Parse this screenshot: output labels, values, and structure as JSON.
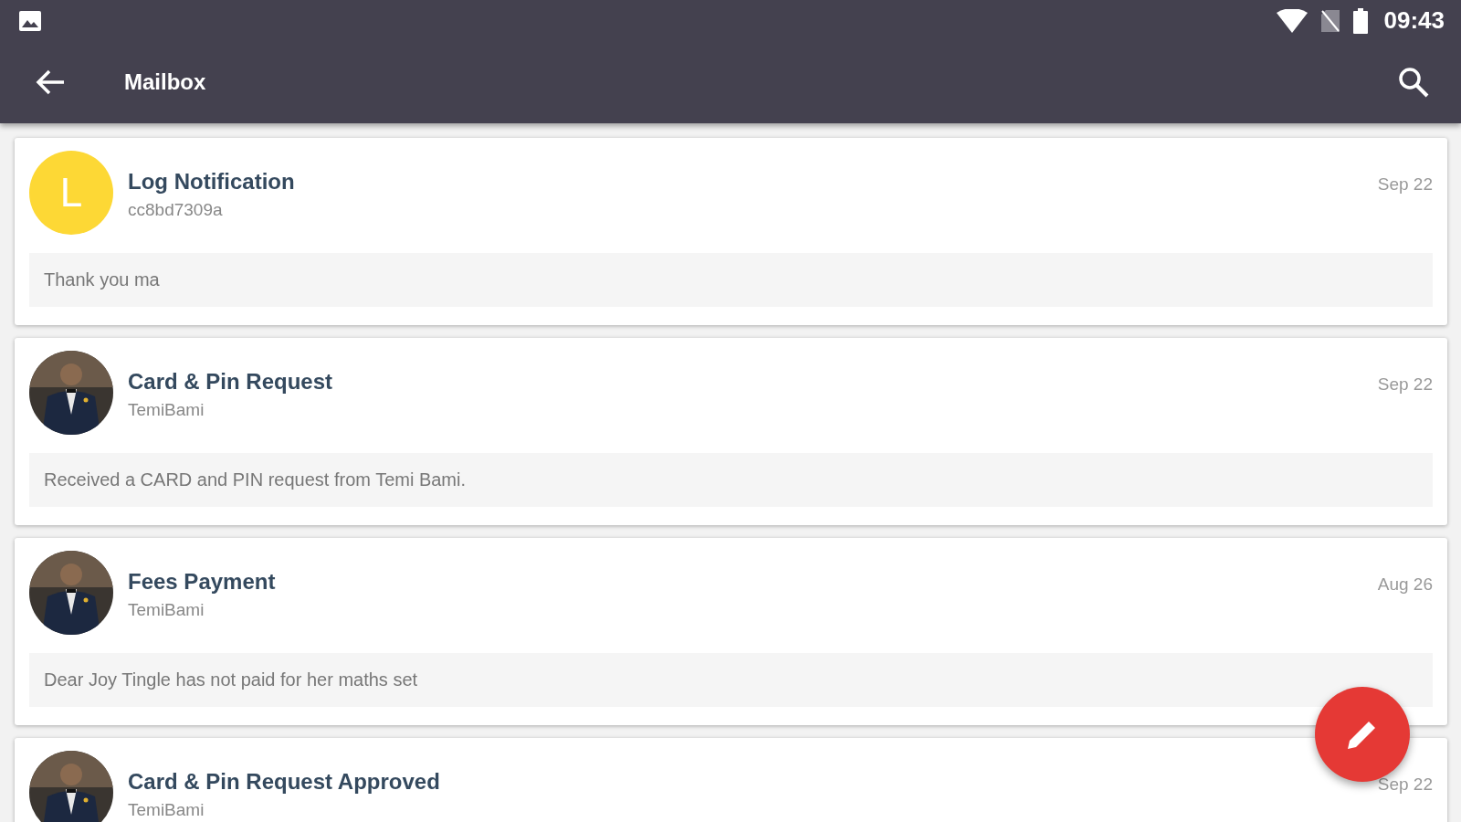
{
  "status_bar": {
    "time": "09:43"
  },
  "app_bar": {
    "title": "Mailbox"
  },
  "messages": [
    {
      "avatar": {
        "kind": "letter",
        "letter": "L"
      },
      "title": "Log Notification",
      "sender": "cc8bd7309a",
      "date": "Sep 22",
      "preview": "Thank you ma"
    },
    {
      "title": "Card & Pin Request",
      "sender": "TemiBami",
      "date": "Sep 22",
      "preview": "Received a CARD and PIN request from Temi Bami."
    },
    {
      "title": "Fees Payment",
      "sender": "TemiBami",
      "date": "Aug 26",
      "preview": "Dear Joy Tingle has not paid for her maths set"
    },
    {
      "title": "Card & Pin Request Approved",
      "sender": "TemiBami",
      "date": "Sep 22"
    }
  ]
}
